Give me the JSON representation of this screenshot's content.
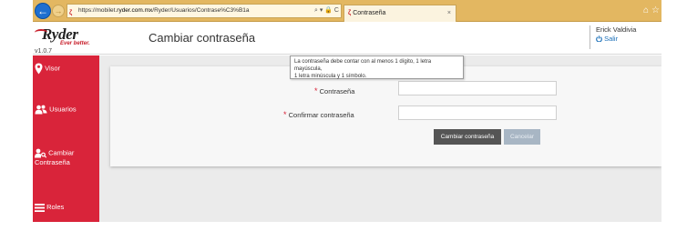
{
  "browser": {
    "url_prefix": "https://mobilet.",
    "url_host": "ryder.com.mx",
    "url_path": "/Ryder/Usuarios/Contrase%C3%B1a",
    "address_tools": "⌕ ▾ 🔒 C",
    "tab_title": "Contraseña",
    "tab_close": "×",
    "back_glyph": "←",
    "forward_glyph": "→",
    "home_glyph": "⌂",
    "star_glyph": "☆",
    "favicon_glyph": "ζ",
    "colors": {
      "chrome": "#e3b761",
      "back_button": "#1f6fd0"
    }
  },
  "header": {
    "logo_word": "Ryder",
    "logo_tagline": "Ever better.",
    "version": "v1.0.7",
    "page_title": "Cambiar contraseña",
    "user_name": "Erick Valdivia",
    "logout_label": "Salir"
  },
  "sidebar": {
    "bg_color": "#d9243a",
    "items": [
      {
        "label": "Visor",
        "icon": "map-pin-icon"
      },
      {
        "label": "Usuarios",
        "icon": "users-icon"
      },
      {
        "label_line1": "Cambiar",
        "label_line2": "Contraseña",
        "icon": "user-key-icon"
      },
      {
        "label": "Roles",
        "icon": "list-icon"
      }
    ]
  },
  "form": {
    "required_mark": "*",
    "password_label": "Contraseña",
    "password_value": "",
    "confirm_label": "Confirmar contraseña",
    "confirm_value": "",
    "submit_label": "Cambiar contraseña",
    "cancel_label": "Cancelar",
    "tooltip_line1": "La contraseña debe contar con al menos 1 dígito, 1 letra mayúscula,",
    "tooltip_line2": "1 letra minúscula y 1 símbolo."
  }
}
